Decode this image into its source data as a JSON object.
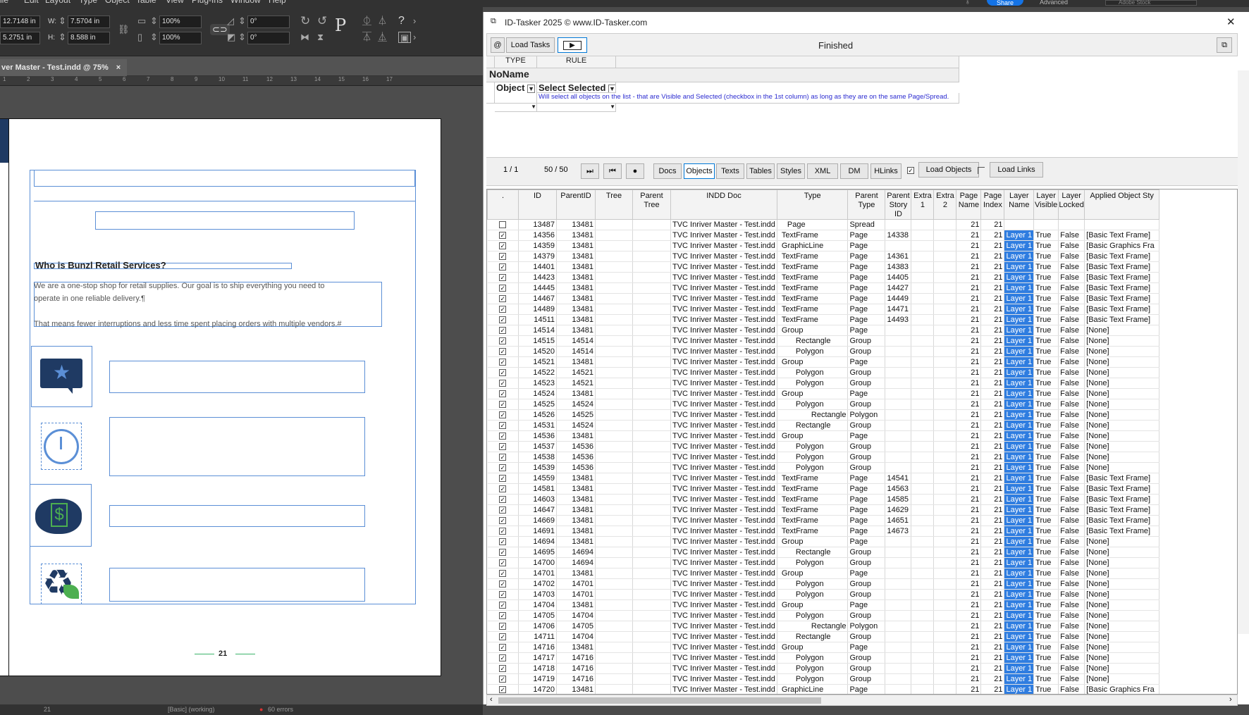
{
  "menu": [
    "ile",
    "Edit",
    "Layout",
    "Type",
    "Object",
    "Table",
    "View",
    "Plug-Ins",
    "Window",
    "Help"
  ],
  "appbar": {
    "share": "Share",
    "workspace": "Advanced",
    "search": "Adobe Stock"
  },
  "control": {
    "x": "12.7148 in",
    "y": "5.2751 in",
    "w": "7.5704 in",
    "h": "8.588 in",
    "w_label": "W:",
    "h_label": "H:",
    "scale_x": "100%",
    "scale_y": "100%",
    "rotate": "0°",
    "shear": "0°"
  },
  "doc_tab": {
    "title": "ver Master - Test.indd @ 75%",
    "close": "×"
  },
  "ruler": [
    "1",
    "2",
    "3",
    "4",
    "5",
    "6",
    "7",
    "8",
    "9",
    "10",
    "11",
    "12",
    "13",
    "14",
    "15",
    "16",
    "17"
  ],
  "page": {
    "heading": "Who is Bunzl Retail Services?",
    "body": [
      "We are a one-stop shop for retail supplies. Our goal is to ship everything you need to",
      "operate in one reliable delivery.¶",
      "That means fewer interruptions and less time spent placing orders with multiple vendors.#"
    ],
    "folio": "21"
  },
  "statusbar": {
    "page": "21",
    "style": "[Basic] (working)",
    "errors": "60 errors"
  },
  "idt": {
    "title": "ID-Tasker 2025  © www.ID-Tasker.com",
    "close": "✕",
    "load_tasks": "Load Tasks",
    "play": "▶",
    "status": "Finished",
    "at": "@",
    "rules_headers": [
      "TYPE",
      "RULE"
    ],
    "rule_name": "NoName",
    "rule_type": "Object",
    "rule_action": "Select Selected",
    "rule_desc": "Will select all objects on the list - that are Visible and Selected (checkbox in the 1st column) as long as they are on the same Page/Spread.",
    "nav": {
      "page": "1 / 1",
      "count": "50 / 50",
      "docs": "Docs",
      "objects": "Objects",
      "texts": "Texts",
      "tables": "Tables",
      "styles": "Styles",
      "xml": "XML",
      "dm": "DM",
      "hlinks": "HLinks",
      "load_objects": "Load Objects",
      "load_links": "Load Links"
    },
    "columns": [
      ".",
      "ID",
      "ParentID",
      "Tree",
      "Parent Tree",
      "INDD Doc",
      "Type",
      "Parent Type",
      "Parent Story ID",
      "Extra 1",
      "Extra 2",
      "Page Name",
      "Page Index",
      "Layer Name",
      "Layer Visible",
      "Layer Locked",
      "Applied Object Sty"
    ],
    "doc": "TVC Inriver Master - Test.indd",
    "rows": [
      [
        "0",
        "13487",
        "13481",
        "Page",
        "Spread",
        "",
        "",
        "Page",
        "",
        "",
        ""
      ],
      [
        "1",
        "14356",
        "13481",
        "TextFrame",
        "Page",
        "14338",
        "Layer 1",
        "True",
        "False",
        "[Basic Text Frame]",
        ""
      ],
      [
        "1",
        "14359",
        "13481",
        "GraphicLine",
        "Page",
        "",
        "Layer 1",
        "True",
        "False",
        "[Basic Graphics Fra",
        ""
      ],
      [
        "1",
        "14379",
        "13481",
        "TextFrame",
        "Page",
        "14361",
        "Layer 1",
        "True",
        "False",
        "[Basic Text Frame]",
        ""
      ],
      [
        "1",
        "14401",
        "13481",
        "TextFrame",
        "Page",
        "14383",
        "Layer 1",
        "True",
        "False",
        "[Basic Text Frame]",
        ""
      ],
      [
        "1",
        "14423",
        "13481",
        "TextFrame",
        "Page",
        "14405",
        "Layer 1",
        "True",
        "False",
        "[Basic Text Frame]",
        ""
      ],
      [
        "1",
        "14445",
        "13481",
        "TextFrame",
        "Page",
        "14427",
        "Layer 1",
        "True",
        "False",
        "[Basic Text Frame]",
        ""
      ],
      [
        "1",
        "14467",
        "13481",
        "TextFrame",
        "Page",
        "14449",
        "Layer 1",
        "True",
        "False",
        "[Basic Text Frame]",
        ""
      ],
      [
        "1",
        "14489",
        "13481",
        "TextFrame",
        "Page",
        "14471",
        "Layer 1",
        "True",
        "False",
        "[Basic Text Frame]",
        ""
      ],
      [
        "1",
        "14511",
        "13481",
        "TextFrame",
        "Page",
        "14493",
        "Layer 1",
        "True",
        "False",
        "[Basic Text Frame]",
        ""
      ],
      [
        "1",
        "14514",
        "13481",
        "Group",
        "Page",
        "",
        "Layer 1",
        "True",
        "False",
        "[None]",
        ""
      ],
      [
        "1",
        "14515",
        "14514",
        "Rectangle",
        "Group",
        "",
        "Layer 1",
        "True",
        "False",
        "[None]",
        ""
      ],
      [
        "1",
        "14520",
        "14514",
        "Polygon",
        "Group",
        "",
        "Layer 1",
        "True",
        "False",
        "[None]",
        ""
      ],
      [
        "1",
        "14521",
        "13481",
        "Group",
        "Page",
        "",
        "Layer 1",
        "True",
        "False",
        "[None]",
        ""
      ],
      [
        "1",
        "14522",
        "14521",
        "Polygon",
        "Group",
        "",
        "Layer 1",
        "True",
        "False",
        "[None]",
        ""
      ],
      [
        "1",
        "14523",
        "14521",
        "Polygon",
        "Group",
        "",
        "Layer 1",
        "True",
        "False",
        "[None]",
        ""
      ],
      [
        "1",
        "14524",
        "13481",
        "Group",
        "Page",
        "",
        "Layer 1",
        "True",
        "False",
        "[None]",
        ""
      ],
      [
        "1",
        "14525",
        "14524",
        "Polygon",
        "Group",
        "",
        "Layer 1",
        "True",
        "False",
        "[None]",
        ""
      ],
      [
        "1",
        "14526",
        "14525",
        "Rectangle",
        "Polygon",
        "",
        "Layer 1",
        "True",
        "False",
        "[None]",
        ""
      ],
      [
        "1",
        "14531",
        "14524",
        "Rectangle",
        "Group",
        "",
        "Layer 1",
        "True",
        "False",
        "[None]",
        ""
      ],
      [
        "1",
        "14536",
        "13481",
        "Group",
        "Page",
        "",
        "Layer 1",
        "True",
        "False",
        "[None]",
        ""
      ],
      [
        "1",
        "14537",
        "14536",
        "Polygon",
        "Group",
        "",
        "Layer 1",
        "True",
        "False",
        "[None]",
        ""
      ],
      [
        "1",
        "14538",
        "14536",
        "Polygon",
        "Group",
        "",
        "Layer 1",
        "True",
        "False",
        "[None]",
        ""
      ],
      [
        "1",
        "14539",
        "14536",
        "Polygon",
        "Group",
        "",
        "Layer 1",
        "True",
        "False",
        "[None]",
        ""
      ],
      [
        "1",
        "14559",
        "13481",
        "TextFrame",
        "Page",
        "14541",
        "Layer 1",
        "True",
        "False",
        "[Basic Text Frame]",
        ""
      ],
      [
        "1",
        "14581",
        "13481",
        "TextFrame",
        "Page",
        "14563",
        "Layer 1",
        "True",
        "False",
        "[Basic Text Frame]",
        ""
      ],
      [
        "1",
        "14603",
        "13481",
        "TextFrame",
        "Page",
        "14585",
        "Layer 1",
        "True",
        "False",
        "[Basic Text Frame]",
        ""
      ],
      [
        "1",
        "14647",
        "13481",
        "TextFrame",
        "Page",
        "14629",
        "Layer 1",
        "True",
        "False",
        "[Basic Text Frame]",
        ""
      ],
      [
        "1",
        "14669",
        "13481",
        "TextFrame",
        "Page",
        "14651",
        "Layer 1",
        "True",
        "False",
        "[Basic Text Frame]",
        ""
      ],
      [
        "1",
        "14691",
        "13481",
        "TextFrame",
        "Page",
        "14673",
        "Layer 1",
        "True",
        "False",
        "[Basic Text Frame]",
        ""
      ],
      [
        "1",
        "14694",
        "13481",
        "Group",
        "Page",
        "",
        "Layer 1",
        "True",
        "False",
        "[None]",
        ""
      ],
      [
        "1",
        "14695",
        "14694",
        "Rectangle",
        "Group",
        "",
        "Layer 1",
        "True",
        "False",
        "[None]",
        ""
      ],
      [
        "1",
        "14700",
        "14694",
        "Polygon",
        "Group",
        "",
        "Layer 1",
        "True",
        "False",
        "[None]",
        ""
      ],
      [
        "1",
        "14701",
        "13481",
        "Group",
        "Page",
        "",
        "Layer 1",
        "True",
        "False",
        "[None]",
        ""
      ],
      [
        "1",
        "14702",
        "14701",
        "Polygon",
        "Group",
        "",
        "Layer 1",
        "True",
        "False",
        "[None]",
        ""
      ],
      [
        "1",
        "14703",
        "14701",
        "Polygon",
        "Group",
        "",
        "Layer 1",
        "True",
        "False",
        "[None]",
        ""
      ],
      [
        "1",
        "14704",
        "13481",
        "Group",
        "Page",
        "",
        "Layer 1",
        "True",
        "False",
        "[None]",
        ""
      ],
      [
        "1",
        "14705",
        "14704",
        "Polygon",
        "Group",
        "",
        "Layer 1",
        "True",
        "False",
        "[None]",
        ""
      ],
      [
        "1",
        "14706",
        "14705",
        "Rectangle",
        "Polygon",
        "",
        "Layer 1",
        "True",
        "False",
        "[None]",
        ""
      ],
      [
        "1",
        "14711",
        "14704",
        "Rectangle",
        "Group",
        "",
        "Layer 1",
        "True",
        "False",
        "[None]",
        ""
      ],
      [
        "1",
        "14716",
        "13481",
        "Group",
        "Page",
        "",
        "Layer 1",
        "True",
        "False",
        "[None]",
        ""
      ],
      [
        "1",
        "14717",
        "14716",
        "Polygon",
        "Group",
        "",
        "Layer 1",
        "True",
        "False",
        "[None]",
        ""
      ],
      [
        "1",
        "14718",
        "14716",
        "Polygon",
        "Group",
        "",
        "Layer 1",
        "True",
        "False",
        "[None]",
        ""
      ],
      [
        "1",
        "14719",
        "14716",
        "Polygon",
        "Group",
        "",
        "Layer 1",
        "True",
        "False",
        "[None]",
        ""
      ],
      [
        "1",
        "14720",
        "13481",
        "GraphicLine",
        "Page",
        "",
        "Layer 1",
        "True",
        "False",
        "[Basic Graphics Fra",
        ""
      ]
    ],
    "page_name": "21",
    "page_index": "21"
  },
  "colors": {
    "selection": "#5b8fd6",
    "layer_highlight": "#2f7de0",
    "icon_navy": "#1f3a63"
  }
}
